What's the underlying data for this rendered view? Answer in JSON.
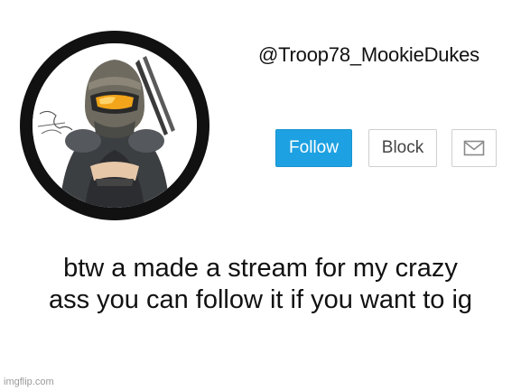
{
  "profile": {
    "username": "@Troop78_MookieDukes",
    "avatar_icon": "armored-helmet-figure-avatar"
  },
  "actions": {
    "follow_label": "Follow",
    "block_label": "Block",
    "message_icon": "envelope-icon"
  },
  "post": {
    "lines": [
      "btw a made a stream for my crazy",
      "ass you can follow it if you want to ig"
    ]
  },
  "watermark": "imgflip.com",
  "colors": {
    "follow_bg": "#1da1e2",
    "ring": "#111111",
    "visor": "#f2a51a"
  }
}
